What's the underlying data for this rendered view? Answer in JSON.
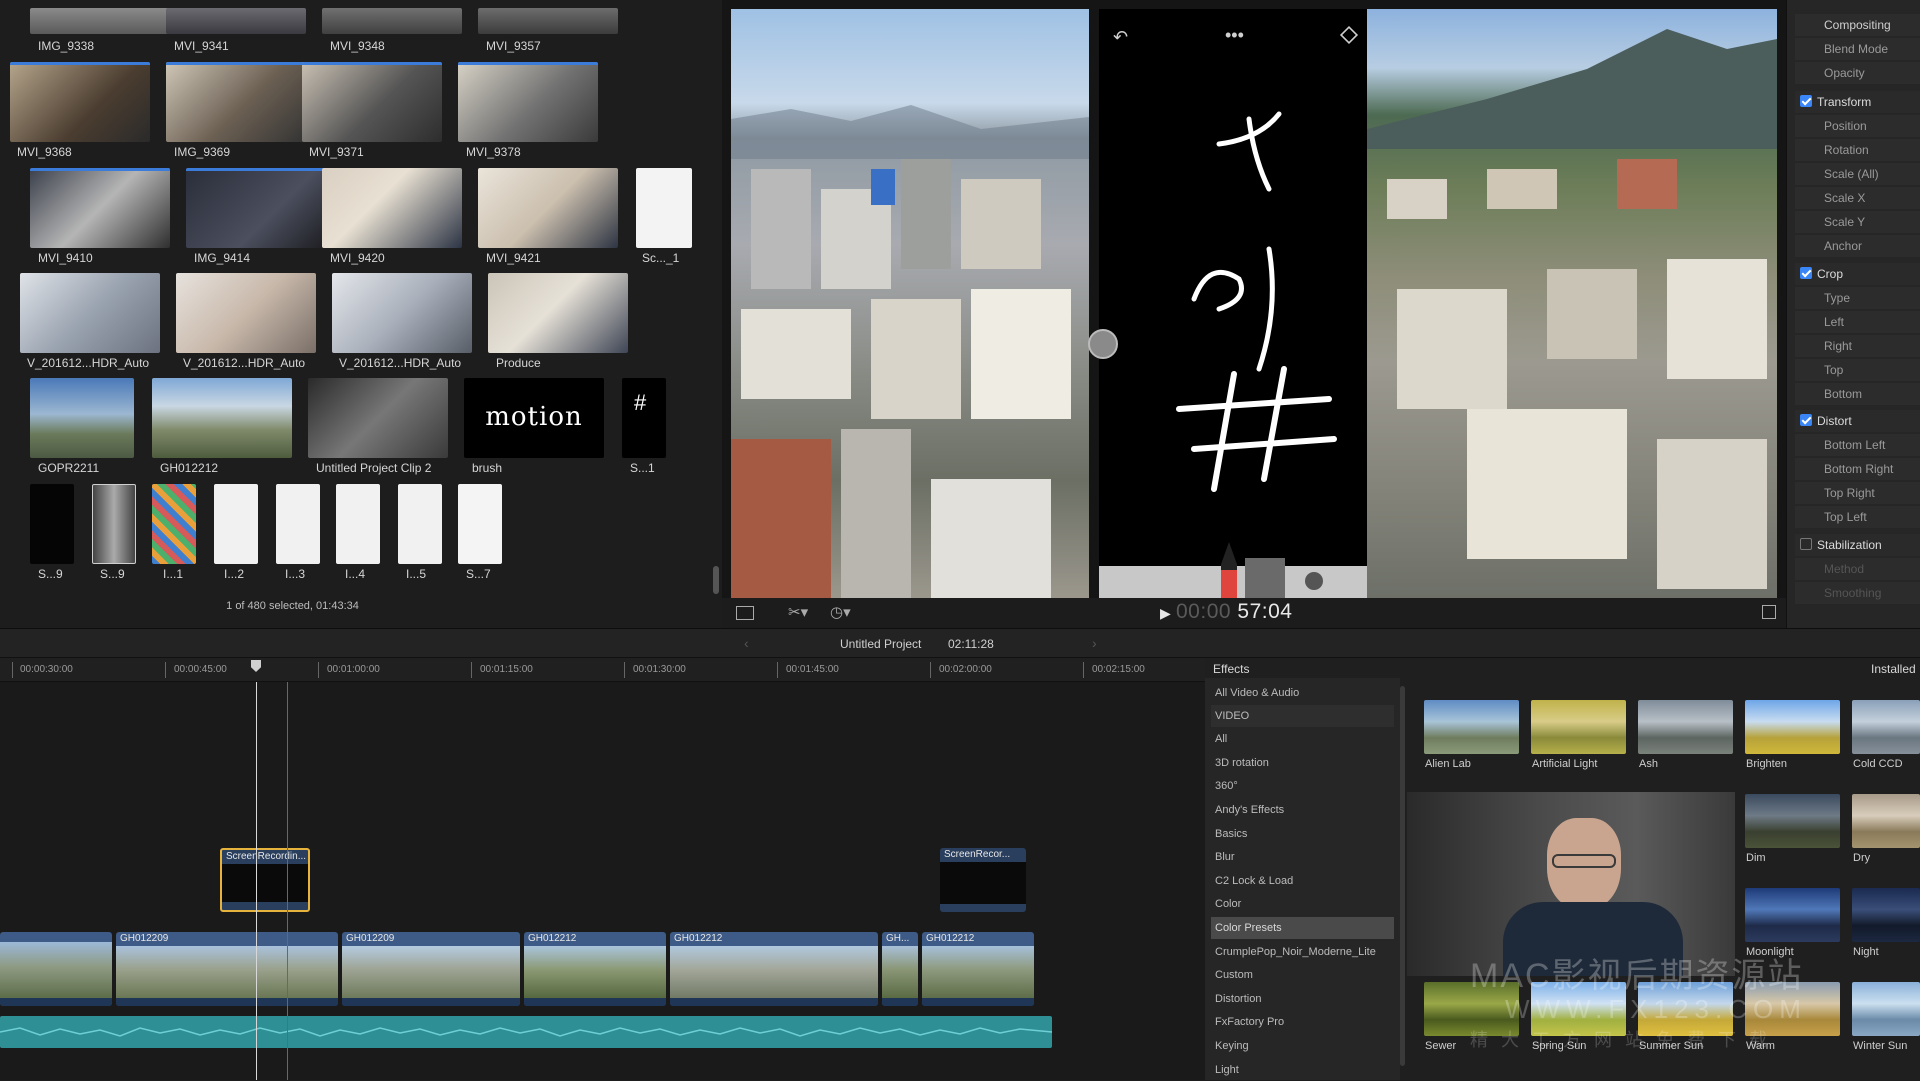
{
  "browser": {
    "clips": [
      {
        "label": "IMG_9338"
      },
      {
        "label": "MVI_9341"
      },
      {
        "label": "MVI_9348"
      },
      {
        "label": "MVI_9357"
      },
      {
        "label": "MVI_9368"
      },
      {
        "label": "IMG_9369"
      },
      {
        "label": "MVI_9371"
      },
      {
        "label": "MVI_9378"
      },
      {
        "label": "MVI_9410"
      },
      {
        "label": "IMG_9414"
      },
      {
        "label": "MVI_9420"
      },
      {
        "label": "MVI_9421"
      },
      {
        "label": "Sc..._1"
      },
      {
        "label": "V_201612...HDR_Auto"
      },
      {
        "label": "V_201612...HDR_Auto"
      },
      {
        "label": "V_201612...HDR_Auto"
      },
      {
        "label": "Produce"
      },
      {
        "label": "GOPR2211"
      },
      {
        "label": "GH012212"
      },
      {
        "label": "Untitled Project Clip 2"
      },
      {
        "label": "brush"
      },
      {
        "label": "S...1"
      },
      {
        "label": "S...9"
      },
      {
        "label": "S...9"
      },
      {
        "label": "I...1"
      },
      {
        "label": "I...2"
      },
      {
        "label": "I...3"
      },
      {
        "label": "I...4"
      },
      {
        "label": "I...5"
      },
      {
        "label": "S...7"
      }
    ],
    "motion_text": "motion",
    "status": "1 of 480 selected, 01:43:34"
  },
  "viewer": {
    "timecode_dim": "00:00",
    "timecode": "57:04",
    "phone_hash": "#"
  },
  "inspector": {
    "compositing": "Compositing",
    "blend_mode": "Blend Mode",
    "opacity": "Opacity",
    "transform": "Transform",
    "position": "Position",
    "rotation": "Rotation",
    "scale_all": "Scale (All)",
    "scale_x": "Scale X",
    "scale_y": "Scale Y",
    "anchor": "Anchor",
    "crop": "Crop",
    "type": "Type",
    "left": "Left",
    "right": "Right",
    "top": "Top",
    "bottom": "Bottom",
    "distort": "Distort",
    "bottom_left": "Bottom Left",
    "bottom_right": "Bottom Right",
    "top_right": "Top Right",
    "top_left": "Top Left",
    "stabilization": "Stabilization",
    "method": "Method",
    "smoothing": "Smoothing"
  },
  "timeline": {
    "project_name": "Untitled Project",
    "duration": "02:11:28",
    "ruler": [
      "00:00:30:00",
      "00:00:45:00",
      "00:01:00:00",
      "00:01:15:00",
      "00:01:30:00",
      "00:01:45:00",
      "00:02:00:00",
      "00:02:15:00"
    ],
    "connected_clips": [
      "ScreenRecordin...",
      "ScreenRecor..."
    ],
    "primary_clips": [
      "GH012209",
      "GH012209",
      "GH012212",
      "GH012212",
      "GH...",
      "GH012212"
    ]
  },
  "effects": {
    "title": "Effects",
    "installed": "Installed",
    "categories": [
      "All Video & Audio",
      "VIDEO",
      "All",
      "3D rotation",
      "360°",
      "Andy's Effects",
      "Basics",
      "Blur",
      "C2 Lock & Load",
      "Color",
      "Color Presets",
      "CrumplePop_Noir_Moderne_Lite",
      "Custom",
      "Distortion",
      "FxFactory Pro",
      "Keying",
      "Light"
    ],
    "presets": [
      "Alien Lab",
      "Artificial Light",
      "Ash",
      "Brighten",
      "Cold CCD",
      "Dim",
      "Dry",
      "Moonlight",
      "Night",
      "Sewer",
      "Spring Sun",
      "Summer Sun",
      "Warm",
      "Winter Sun"
    ]
  },
  "watermark": {
    "line1": "MAC影视后期资源站",
    "line2": "WWW.FX123.COM",
    "line3": "精 大 工 方 网 站   免 费 下 载"
  }
}
